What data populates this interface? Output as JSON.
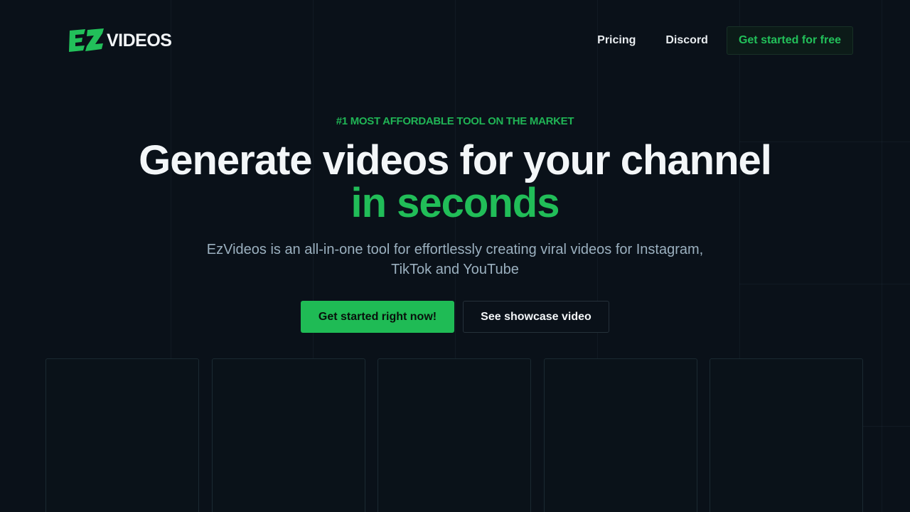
{
  "brand": {
    "logo_mark": "EZ",
    "logo_text": "VIDEOS",
    "accent_color": "#22c05a"
  },
  "nav": {
    "pricing": "Pricing",
    "discord": "Discord",
    "cta": "Get started for free"
  },
  "hero": {
    "eyebrow": "#1 MOST AFFORDABLE TOOL ON THE MARKET",
    "headline_line1": "Generate videos for your channel",
    "headline_line2": "in seconds",
    "subtitle_line1": "EzVideos is an all-in-one tool for effortlessly creating viral videos for Instagram,",
    "subtitle_line2": "TikTok and YouTube",
    "primary_button": "Get started right now!",
    "secondary_button": "See showcase video"
  },
  "cards": [
    {
      "id": "video-card-1"
    },
    {
      "id": "video-card-2"
    },
    {
      "id": "video-card-3"
    },
    {
      "id": "video-card-4"
    },
    {
      "id": "video-card-5"
    }
  ]
}
